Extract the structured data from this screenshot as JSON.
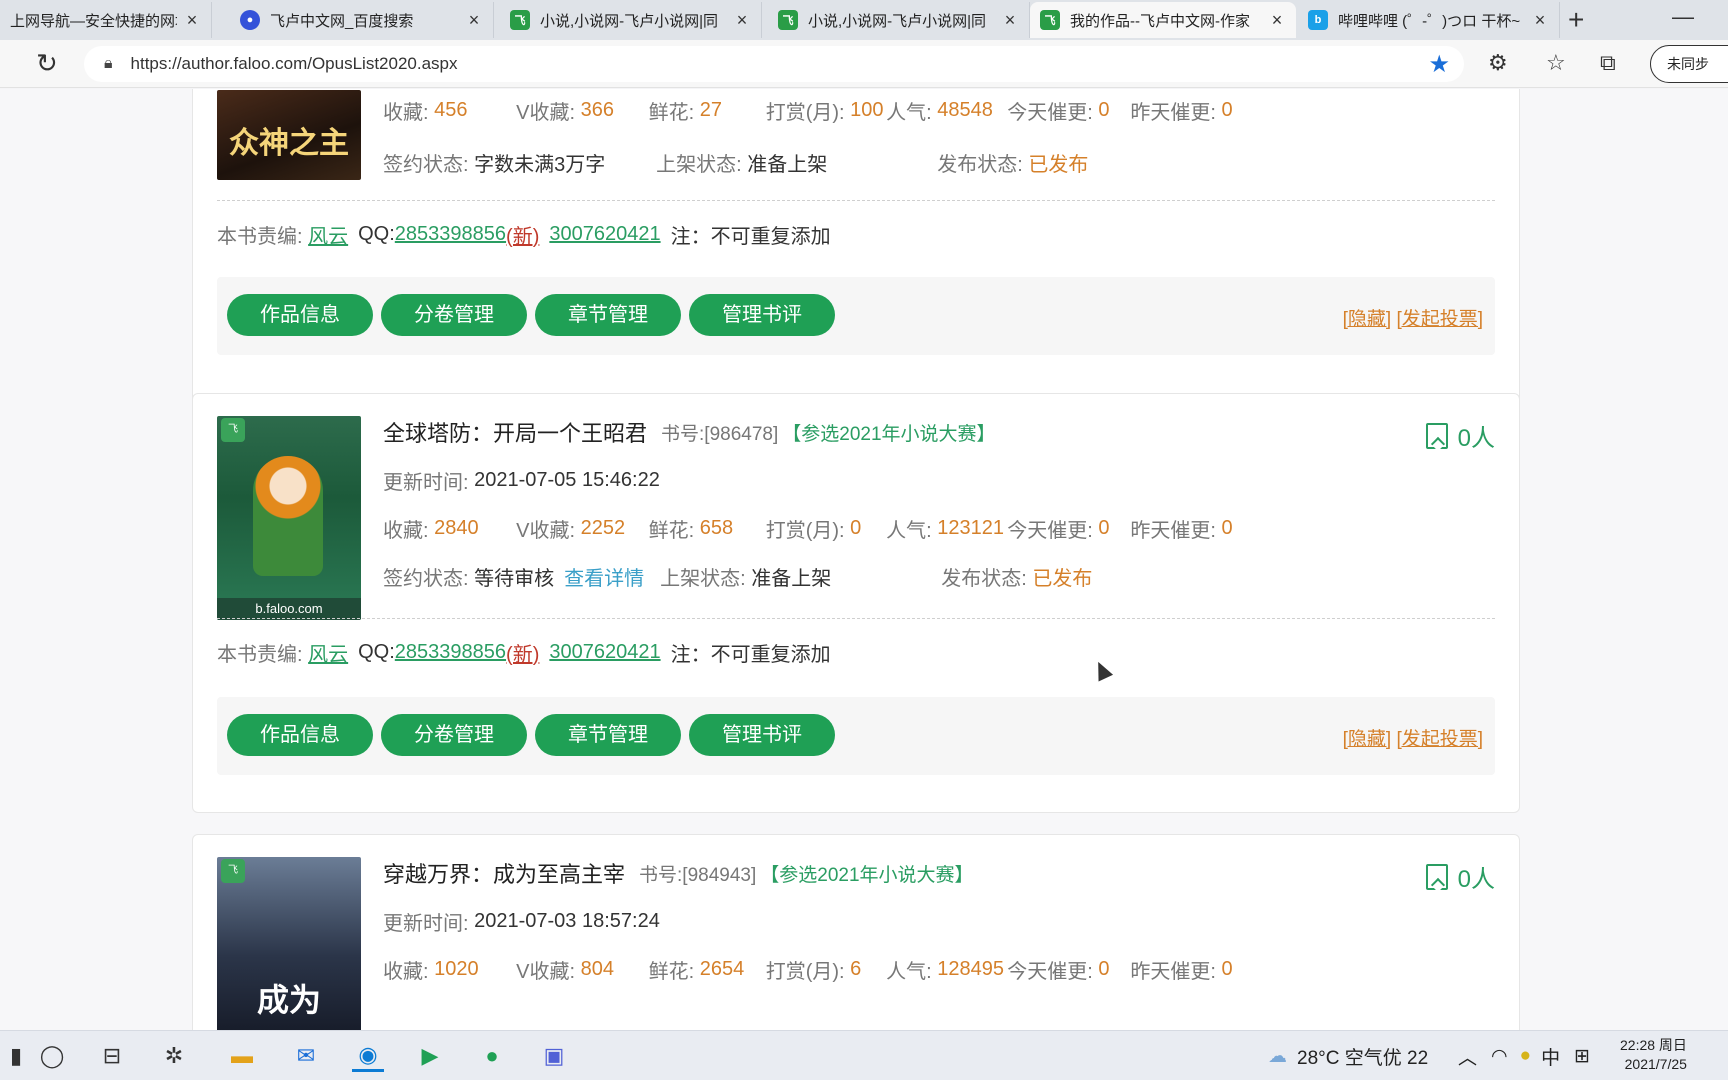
{
  "browser": {
    "tabs": [
      {
        "title": "上网导航—安全快捷的网址",
        "icon": "edge-globe-icon"
      },
      {
        "title": "飞卢中文网_百度搜索",
        "icon": "baidu-paw-icon"
      },
      {
        "title": "小说,小说网-飞卢小说网|同",
        "icon": "faloo-icon"
      },
      {
        "title": "小说,小说网-飞卢小说网|同",
        "icon": "faloo-icon"
      },
      {
        "title": "我的作品--飞卢中文网-作家",
        "icon": "faloo-icon"
      },
      {
        "title": "哔哩哔哩 (゜-゜)つロ 干杯~",
        "icon": "bilibili-icon"
      }
    ],
    "url": "https://author.faloo.com/OpusList2020.aspx",
    "sync_label": "未同步"
  },
  "books": [
    {
      "stats": {
        "shoucang": "456",
        "vshoucang": "366",
        "xianhua": "27",
        "dashang": "100",
        "renqi": "48548",
        "today": "0",
        "yesterday": "0"
      },
      "sign_status": "字数未满3万字",
      "shelf_status": "准备上架",
      "publish_status": "已发布",
      "cover_text": "众神之主"
    },
    {
      "title": "全球塔防：开局一个王昭君",
      "book_id": "书号:[986478]",
      "contest": "【参选2021年小说大赛】",
      "fans": "0人",
      "update_time": "2021-07-05 15:46:22",
      "stats": {
        "shoucang": "2840",
        "vshoucang": "2252",
        "xianhua": "658",
        "dashang": "0",
        "renqi": "123121",
        "today": "0",
        "yesterday": "0"
      },
      "sign_status": "等待审核",
      "sign_link": "查看详情",
      "shelf_status": "准备上架",
      "publish_status": "已发布",
      "cover_band": "b.faloo.com"
    },
    {
      "title": "穿越万界：成为至高主宰",
      "book_id": "书号:[984943]",
      "contest": "【参选2021年小说大赛】",
      "fans": "0人",
      "update_time": "2021-07-03 18:57:24",
      "stats": {
        "shoucang": "1020",
        "vshoucang": "804",
        "xianhua": "2654",
        "dashang": "6",
        "renqi": "128495",
        "today": "0",
        "yesterday": "0"
      },
      "cover_text": "成为"
    }
  ],
  "labels": {
    "shoucang": "收藏:",
    "vshoucang": "V收藏:",
    "xianhua": "鲜花:",
    "dashang": "打赏(月):",
    "renqi": "人气:",
    "today": "今天催更:",
    "yesterday": "昨天催更:",
    "sign": "签约状态:",
    "shelf": "上架状态:",
    "publish": "发布状态:",
    "update": "更新时间:",
    "editor": "本书责编:",
    "qq": "QQ:",
    "note": "注：不可重复添加"
  },
  "editor": {
    "name": "风云",
    "qq1": "2853398856",
    "new_tag": "(新)",
    "qq2": "3007620421"
  },
  "actions": {
    "info": "作品信息",
    "volume": "分卷管理",
    "chapter": "章节管理",
    "review": "管理书评",
    "hide": "[隐藏]",
    "vote": "[发起投票]"
  },
  "taskbar": {
    "weather": "28°C 空气优 22",
    "ime": "中",
    "time": "22:28 周日",
    "date": "2021/7/25"
  }
}
